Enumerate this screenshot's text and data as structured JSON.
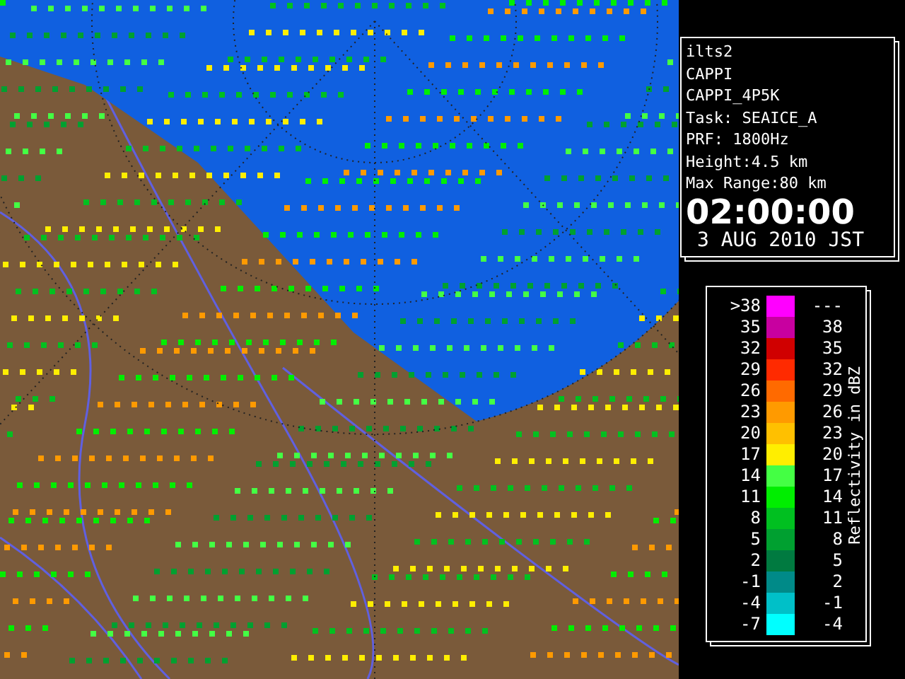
{
  "info_panel": {
    "lines": [
      "ilts2",
      "CAPPI",
      "CAPPI_4P5K",
      "Task: SEAICE_A",
      "PRF: 1800Hz",
      "Height:4.5 km",
      "Max Range:80 km"
    ],
    "time": "02:00:00",
    "date": "3 AUG 2010 JST"
  },
  "legend": {
    "title": "Reflectivity in dBZ",
    "rows": [
      {
        "low": ">38",
        "high": "---",
        "color": "#ff00ff"
      },
      {
        "low": "35",
        "high": "38",
        "color": "#c800a0"
      },
      {
        "low": "32",
        "high": "35",
        "color": "#d00000"
      },
      {
        "low": "29",
        "high": "32",
        "color": "#ff2a00"
      },
      {
        "low": "26",
        "high": "29",
        "color": "#ff6a00"
      },
      {
        "low": "23",
        "high": "26",
        "color": "#ff9a00"
      },
      {
        "low": "20",
        "high": "23",
        "color": "#ffc000"
      },
      {
        "low": "17",
        "high": "20",
        "color": "#ffee00"
      },
      {
        "low": "14",
        "high": "17",
        "color": "#44ff44"
      },
      {
        "low": "11",
        "high": "14",
        "color": "#00ee00"
      },
      {
        "low": "8",
        "high": "11",
        "color": "#00c020"
      },
      {
        "low": "5",
        "high": "8",
        "color": "#00a030"
      },
      {
        "low": "2",
        "high": "5",
        "color": "#007a40"
      },
      {
        "low": "-1",
        "high": "2",
        "color": "#008a88"
      },
      {
        "low": "-4",
        "high": "-1",
        "color": "#00c0c8"
      },
      {
        "low": "-7",
        "high": "-4",
        "color": "#00ffff"
      }
    ]
  }
}
